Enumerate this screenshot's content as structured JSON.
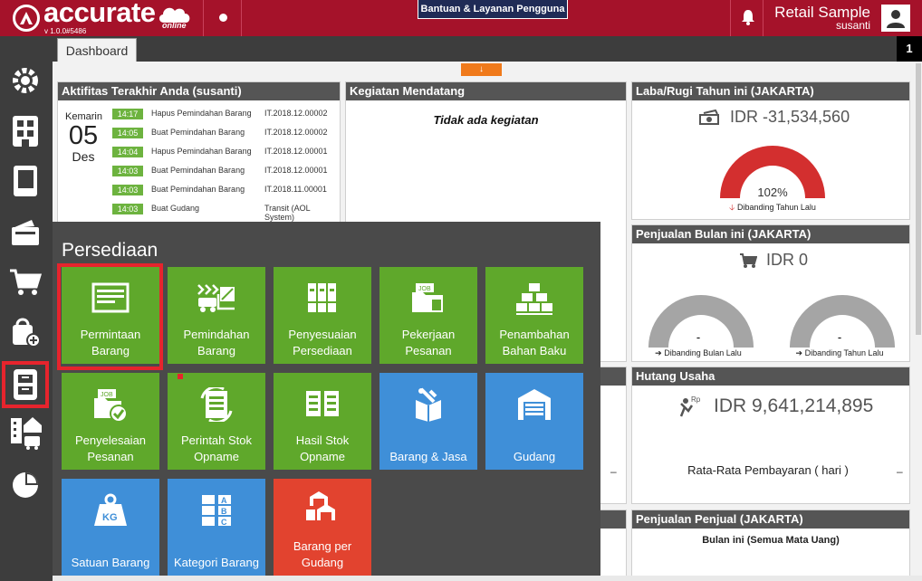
{
  "topbar": {
    "brand": "accurate",
    "brand_sub": "online",
    "version": "v 1.0.0#5486",
    "help_label": "Bantuan & Layanan Pengguna",
    "company": "Retail Sample",
    "user": "susanti",
    "color": "#a5122a"
  },
  "tabs": {
    "active_label": "Dashboard",
    "count": "1"
  },
  "sidebar": {
    "items": [
      {
        "name": "settings",
        "icon": "gear-icon"
      },
      {
        "name": "company",
        "icon": "building-grid-icon"
      },
      {
        "name": "ledger",
        "icon": "ledger-book-icon"
      },
      {
        "name": "cash-bank",
        "icon": "wallet-icon"
      },
      {
        "name": "sales",
        "icon": "cart-icon"
      },
      {
        "name": "purchase",
        "icon": "shopping-bag-add-icon"
      },
      {
        "name": "inventory",
        "icon": "cabinet-icon",
        "active": true
      },
      {
        "name": "fixed-assets",
        "icon": "building-car-icon"
      },
      {
        "name": "reports",
        "icon": "pie-chart-icon"
      }
    ]
  },
  "activities": {
    "title": "Aktifitas Terakhir Anda (susanti)",
    "date_label": "Kemarin",
    "day": "05",
    "month": "Des",
    "rows": [
      {
        "time": "14:17",
        "desc": "Hapus Pemindahan Barang",
        "ref": "IT.2018.12.00002"
      },
      {
        "time": "14:05",
        "desc": "Buat Pemindahan Barang",
        "ref": "IT.2018.12.00002"
      },
      {
        "time": "14:04",
        "desc": "Hapus Pemindahan Barang",
        "ref": "IT.2018.12.00001"
      },
      {
        "time": "14:03",
        "desc": "Buat Pemindahan Barang",
        "ref": "IT.2018.12.00001"
      },
      {
        "time": "14:03",
        "desc": "Buat Pemindahan Barang",
        "ref": "IT.2018.11.00001"
      },
      {
        "time": "14:03",
        "desc": "Buat Gudang",
        "ref": "Transit (AOL System)"
      }
    ]
  },
  "upcoming": {
    "title": "Kegiatan Mendatang",
    "empty": "Tidak ada kegiatan"
  },
  "profit": {
    "title": "Laba/Rugi Tahun ini (JAKARTA)",
    "amount": "IDR -31,534,560",
    "percent": "102%",
    "percent_value": 102,
    "compare": "Dibanding Tahun Lalu",
    "color": "#d32f2f"
  },
  "sales": {
    "title": "Penjualan Bulan ini (JAKARTA)",
    "amount": "IDR 0",
    "left_value": "-",
    "left_compare": "Dibanding Bulan Lalu",
    "right_value": "-",
    "right_compare": "Dibanding Tahun Lalu"
  },
  "debt": {
    "title": "Hutang Usaha",
    "amount": "IDR 9,641,214,895",
    "avg_label": "Rata-Rata Pembayaran ( hari )",
    "avg_value": "–",
    "left_dash": "–"
  },
  "seller_sales": {
    "title": "Penjualan Penjual (JAKARTA)",
    "subtitle": "Bulan ini (Semua Mata Uang)"
  },
  "inventory_menu": {
    "title": "Persediaan",
    "tiles": [
      {
        "label": "Permintaan Barang",
        "color": "green",
        "icon": "request-form-icon"
      },
      {
        "label": "Pemindahan Barang",
        "color": "green",
        "icon": "forklift-transfer-icon"
      },
      {
        "label": "Penyesuaian Persediaan",
        "color": "green",
        "icon": "binders-icon"
      },
      {
        "label": "Pekerjaan Pesanan",
        "color": "green",
        "icon": "job-folder-icon"
      },
      {
        "label": "Penambahan Bahan Baku",
        "color": "green",
        "icon": "material-boxes-icon"
      },
      {
        "label": "Penyelesaian Pesanan",
        "color": "green",
        "icon": "job-complete-icon"
      },
      {
        "label": "Perintah Stok Opname",
        "color": "green",
        "icon": "stock-order-icon"
      },
      {
        "label": "Hasil Stok Opname",
        "color": "green",
        "icon": "stock-result-icon"
      },
      {
        "label": "Barang & Jasa",
        "color": "blue",
        "icon": "goods-services-icon"
      },
      {
        "label": "Gudang",
        "color": "blue",
        "icon": "warehouse-icon"
      },
      {
        "label": "Satuan Barang",
        "color": "blue",
        "icon": "weight-kg-icon"
      },
      {
        "label": "Kategori Barang",
        "color": "blue",
        "icon": "category-abc-icon"
      },
      {
        "label": "Barang per Gudang",
        "color": "red",
        "icon": "items-per-warehouse-icon"
      }
    ]
  }
}
